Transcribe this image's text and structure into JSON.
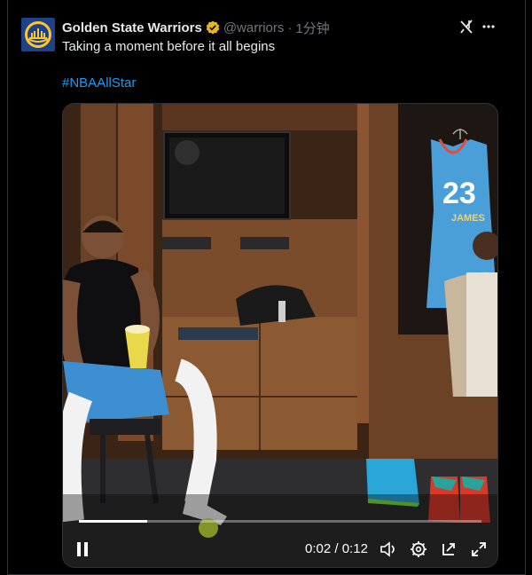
{
  "post": {
    "author_name": "Golden State Warriors",
    "handle": "@warriors",
    "separator": "·",
    "time": "1分钟",
    "text": "Taking a moment before it all begins",
    "hashtag": "#NBAAllStar"
  },
  "video": {
    "current_time": "0:02",
    "time_separator": "/",
    "duration": "0:12",
    "progress_fraction": 0.17,
    "jersey_number": "23",
    "jersey_name": "JAMES"
  },
  "icons": [
    "team-logo",
    "verified-badge-icon",
    "grok-icon",
    "more-icon",
    "pause-icon",
    "volume-icon",
    "settings-icon",
    "popout-icon",
    "fullscreen-icon"
  ],
  "colors": {
    "link": "#1d9bf0",
    "verified": "#e2b719",
    "avatar_bg": "#1d428a"
  }
}
